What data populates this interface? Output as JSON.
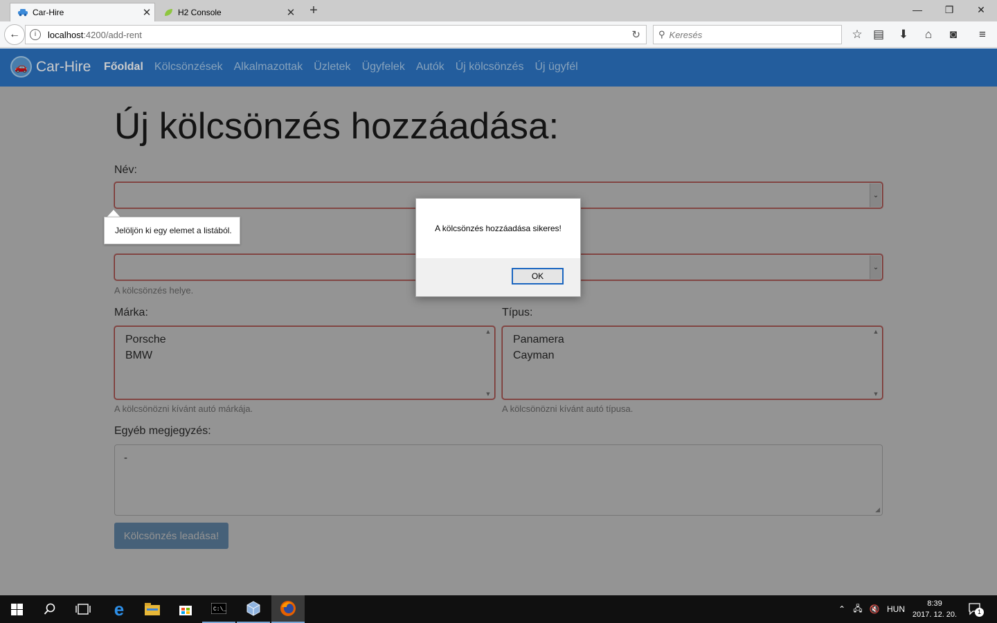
{
  "browser": {
    "tabs": [
      {
        "label": "Car-Hire",
        "icon": "car-icon",
        "active": true
      },
      {
        "label": "H2 Console",
        "icon": "leaf-icon",
        "active": false
      }
    ],
    "url": {
      "host": "localhost",
      "path": ":4200/add-rent"
    },
    "search_placeholder": "Keresés"
  },
  "app": {
    "brand": "Car-Hire",
    "nav": [
      {
        "label": "Főoldal",
        "active": true
      },
      {
        "label": "Kölcsönzések"
      },
      {
        "label": "Alkalmazottak"
      },
      {
        "label": "Üzletek"
      },
      {
        "label": "Ügyfelek"
      },
      {
        "label": "Autók"
      },
      {
        "label": "Új kölcsönzés"
      },
      {
        "label": "Új ügyfél"
      }
    ],
    "accent_color": "#2c75c5"
  },
  "form": {
    "title": "Új kölcsönzés hozzáadása:",
    "name_label": "Név:",
    "place_help": "A kölcsönzés helye.",
    "brand_label": "Márka:",
    "brand_options": [
      "Porsche",
      "BMW"
    ],
    "brand_help": "A kölcsönözni kívánt autó márkája.",
    "type_label": "Típus:",
    "type_options": [
      "Panamera",
      "Cayman"
    ],
    "type_help": "A kölcsönözni kívánt autó típusa.",
    "note_label": "Egyéb megjegyzés:",
    "note_value": "-",
    "submit_label": "Kölcsönzés leadása!"
  },
  "validation_tooltip": "Jelöljön ki egy elemet a listából.",
  "dialog": {
    "message": "A kölcsönzés hozzáadása sikeres!",
    "ok_label": "OK"
  },
  "taskbar": {
    "language": "HUN",
    "time": "8:39",
    "date": "2017. 12. 20.",
    "notification_count": "1"
  }
}
